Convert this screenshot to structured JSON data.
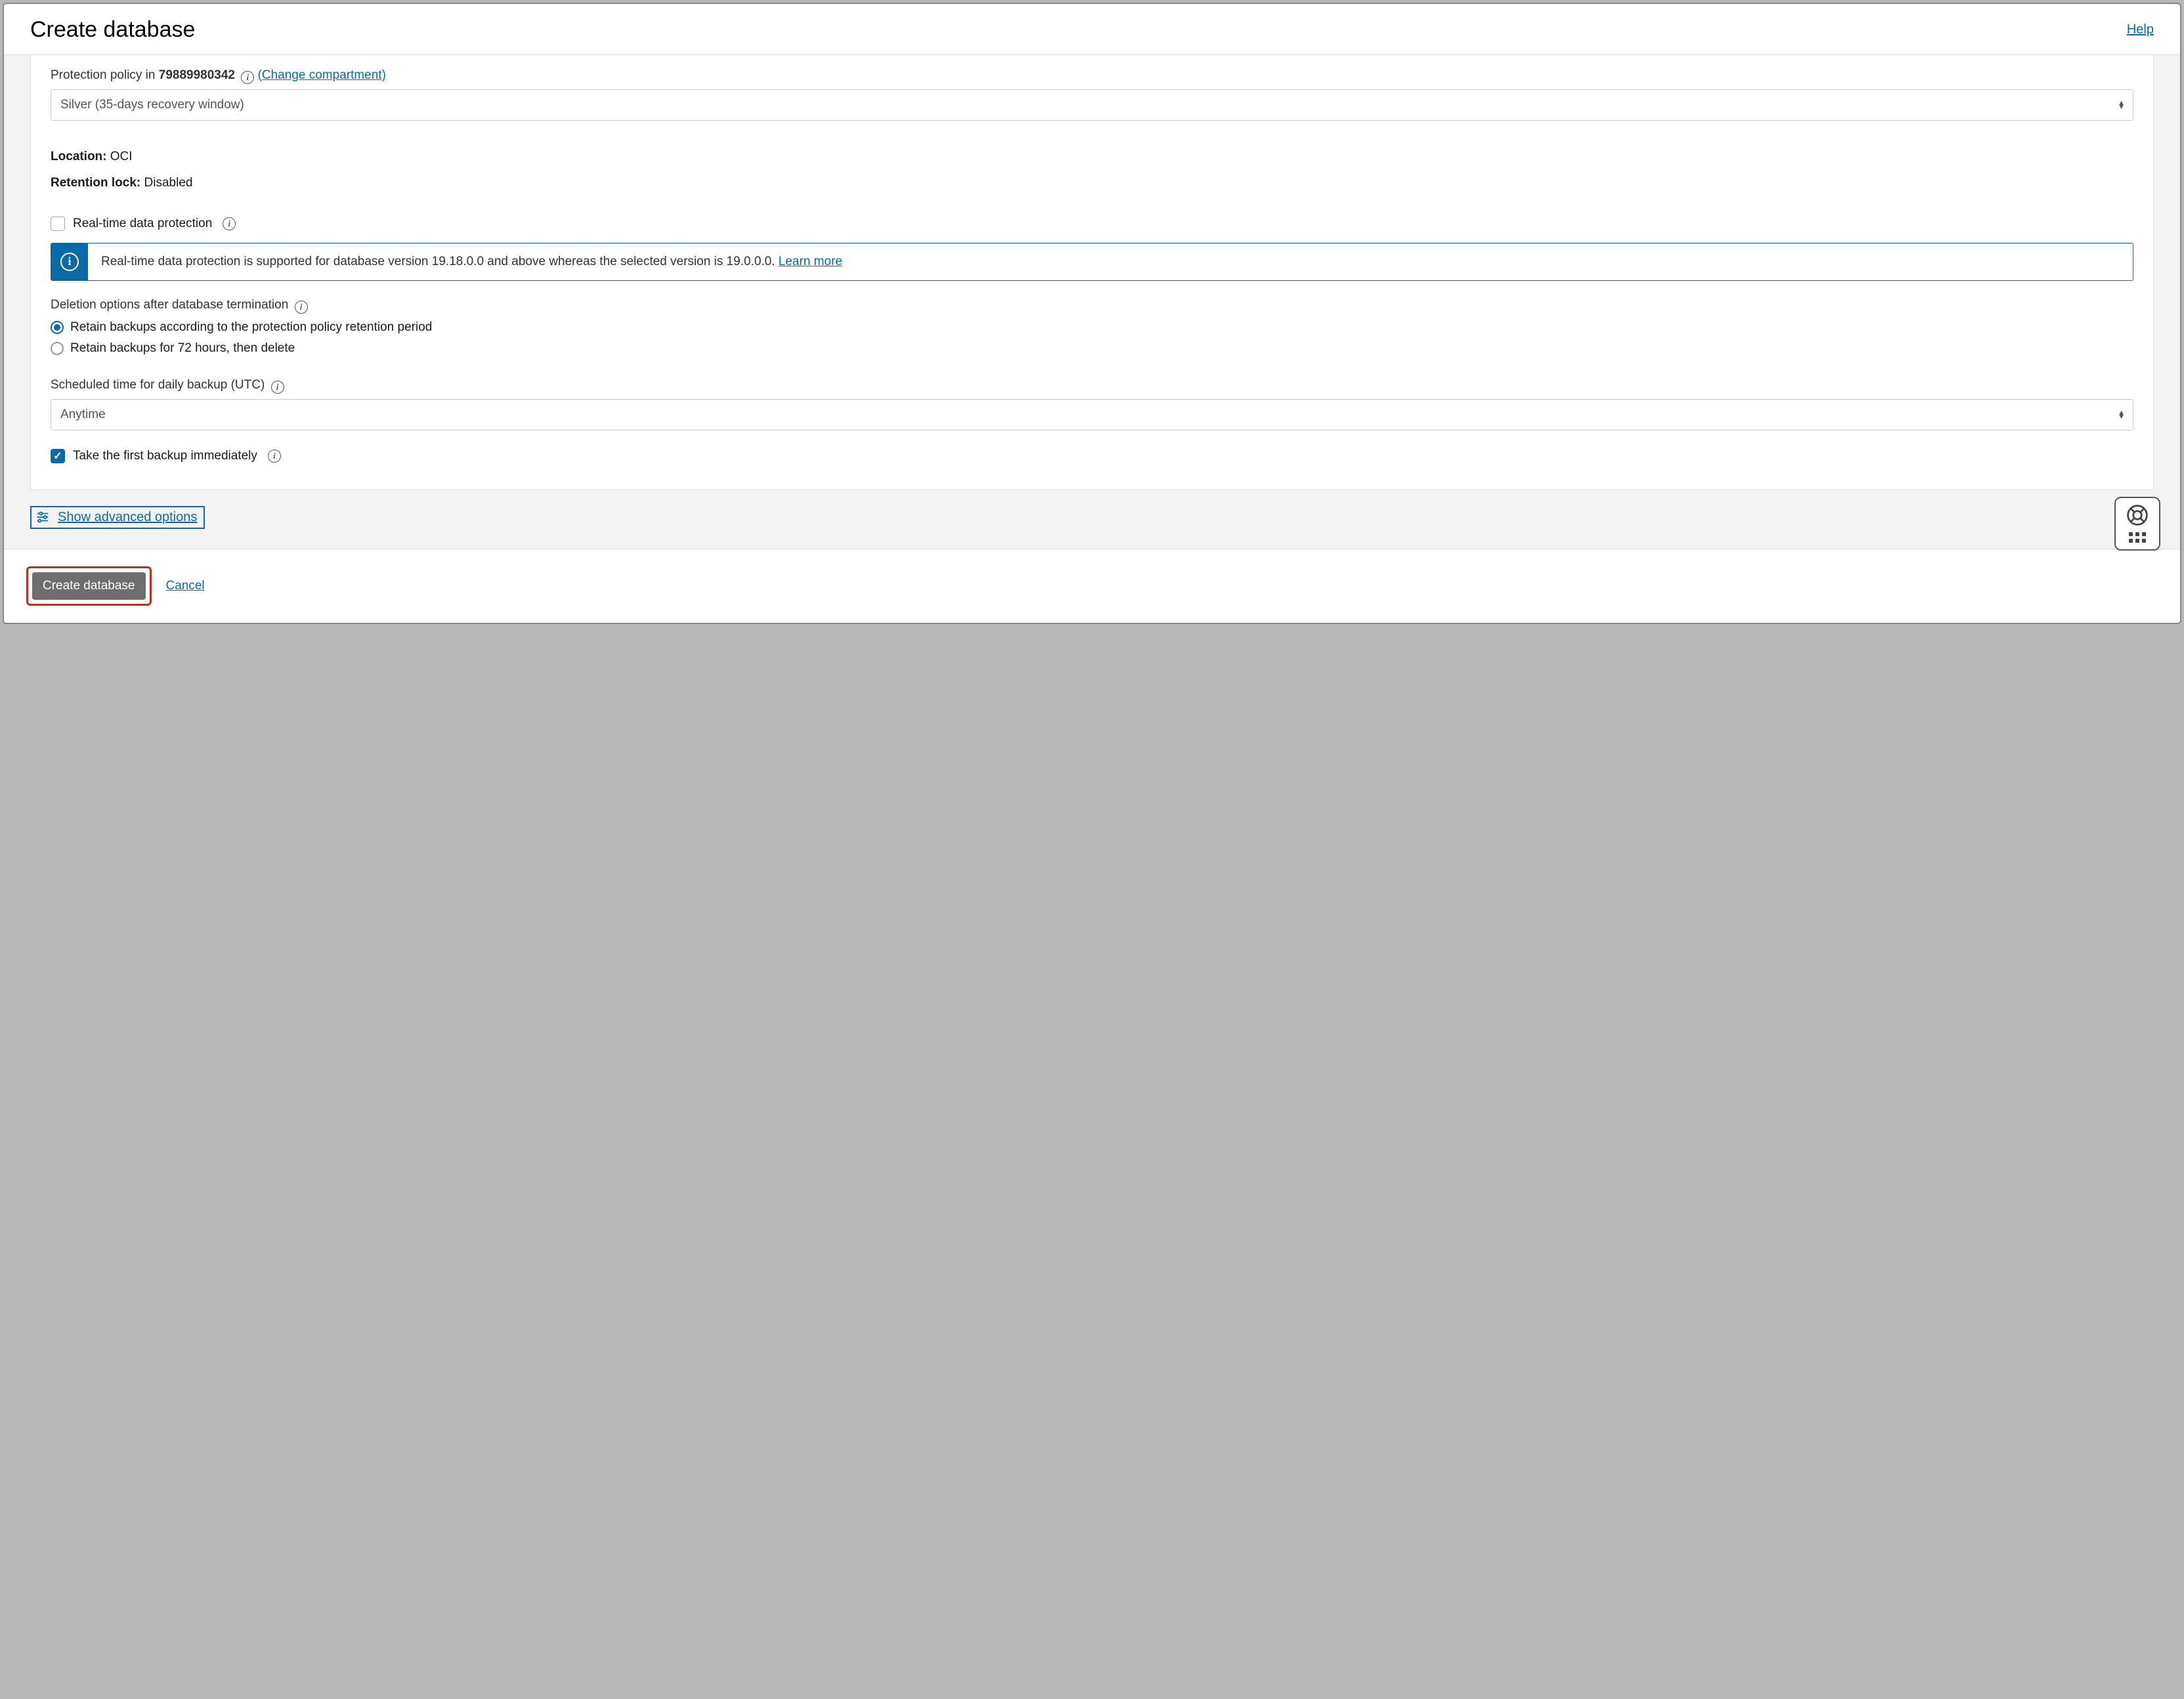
{
  "header": {
    "title": "Create database",
    "help": "Help"
  },
  "policy": {
    "label_prefix": "Protection policy in ",
    "compartment_id": "79889980342",
    "change_link": "(Change compartment)",
    "selected": "Silver (35-days recovery window)"
  },
  "location": {
    "label": "Location:",
    "value": "OCI"
  },
  "retention_lock": {
    "label": "Retention lock:",
    "value": "Disabled"
  },
  "realtime": {
    "checkbox_label": "Real-time data protection",
    "banner_text": "Real-time data protection is supported for database version 19.18.0.0 and above whereas the selected version is 19.0.0.0. ",
    "learn_more": "Learn more"
  },
  "deletion": {
    "heading": "Deletion options after database termination",
    "opt1": "Retain backups according to the protection policy retention period",
    "opt2": "Retain backups for 72 hours, then delete"
  },
  "schedule": {
    "label": "Scheduled time for daily backup (UTC)",
    "selected": "Anytime"
  },
  "first_backup": {
    "label": "Take the first backup immediately"
  },
  "advanced": {
    "label": "Show advanced options"
  },
  "footer": {
    "create": "Create database",
    "cancel": "Cancel"
  }
}
